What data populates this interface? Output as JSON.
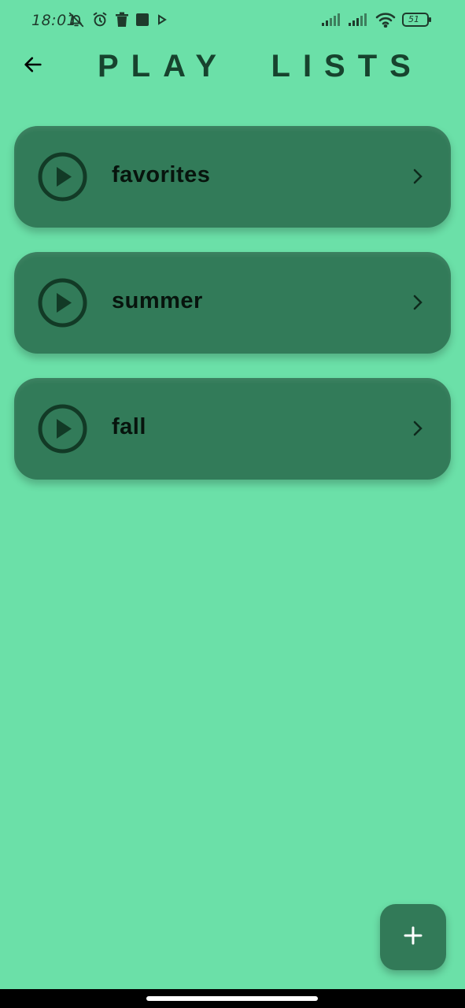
{
  "status_bar": {
    "time": "18:01",
    "battery_level": "51",
    "icons": [
      "bell-off-icon",
      "alarm-icon",
      "trash-icon",
      "square-icon",
      "play-store-icon",
      "signal-icon",
      "signal-icon",
      "wifi-icon",
      "battery-icon"
    ]
  },
  "header": {
    "title": "PLAY  LISTS",
    "back_icon": "arrow-left-icon"
  },
  "playlists": [
    {
      "name": "favorites"
    },
    {
      "name": "summer"
    },
    {
      "name": "fall"
    }
  ],
  "fab": {
    "icon": "plus-icon"
  },
  "colors": {
    "background": "#6be0a8",
    "card": "#327b59",
    "title": "#17432e",
    "icon_dark": "#123a26",
    "fab": "#327a58"
  }
}
